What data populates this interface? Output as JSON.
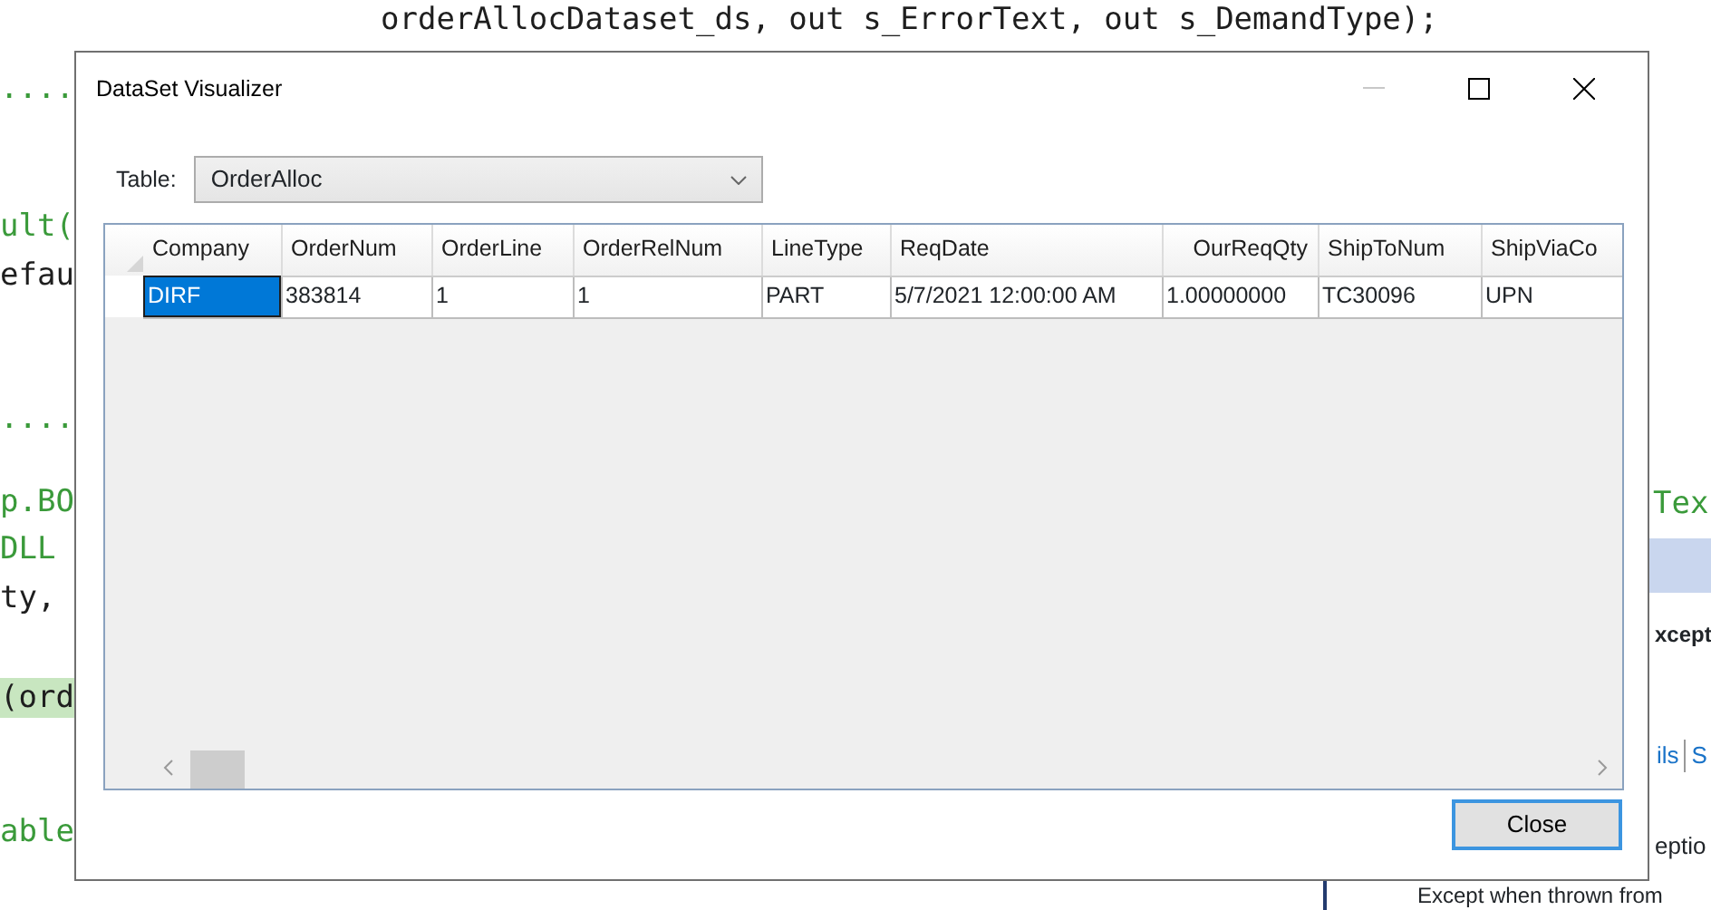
{
  "background_editor": {
    "code_fragments": [
      {
        "text": "orderAllocDataset_ds, out s_ErrorText, out s_DemandType);",
        "kind": "code"
      },
      {
        "text": "....",
        "kind": "comment"
      },
      {
        "text": "ult(",
        "kind": "comment"
      },
      {
        "text": "efau",
        "kind": "code"
      },
      {
        "text": "....",
        "kind": "comment"
      },
      {
        "text": "p.BO",
        "kind": "comment"
      },
      {
        "text": "DLL",
        "kind": "comment"
      },
      {
        "text": "ty,",
        "kind": "code"
      },
      {
        "text": "(ord",
        "kind": "highlighted"
      },
      {
        "text": "able",
        "kind": "comment"
      },
      {
        "text": "Tex",
        "kind": "comment"
      }
    ]
  },
  "exception_panel": {
    "heading": "xcept",
    "links": [
      "ils",
      "S"
    ],
    "line_1": "eptio",
    "line_2": "Except when thrown from"
  },
  "window": {
    "title": "DataSet Visualizer",
    "minimize_disabled": true,
    "table_label": "Table:",
    "table_select": "OrderAlloc",
    "grid": {
      "columns": [
        "Company",
        "OrderNum",
        "OrderLine",
        "OrderRelNum",
        "LineType",
        "ReqDate",
        "OurReqQty",
        "ShipToNum",
        "ShipViaCo"
      ],
      "rows": [
        {
          "cells": [
            {
              "text": "DIRF",
              "selected": true
            },
            {
              "text": "383814",
              "selected": false
            },
            {
              "text": "1",
              "selected": false
            },
            {
              "text": "1",
              "selected": false
            },
            {
              "text": "PART",
              "selected": false
            },
            {
              "text": "5/7/2021 12:00:00 AM",
              "selected": false
            },
            {
              "text": "1.00000000",
              "selected": false
            },
            {
              "text": "TC30096",
              "selected": false
            },
            {
              "text": "UPN",
              "selected": false
            }
          ]
        }
      ]
    },
    "close_button": {
      "label": "Close",
      "default": true
    }
  }
}
